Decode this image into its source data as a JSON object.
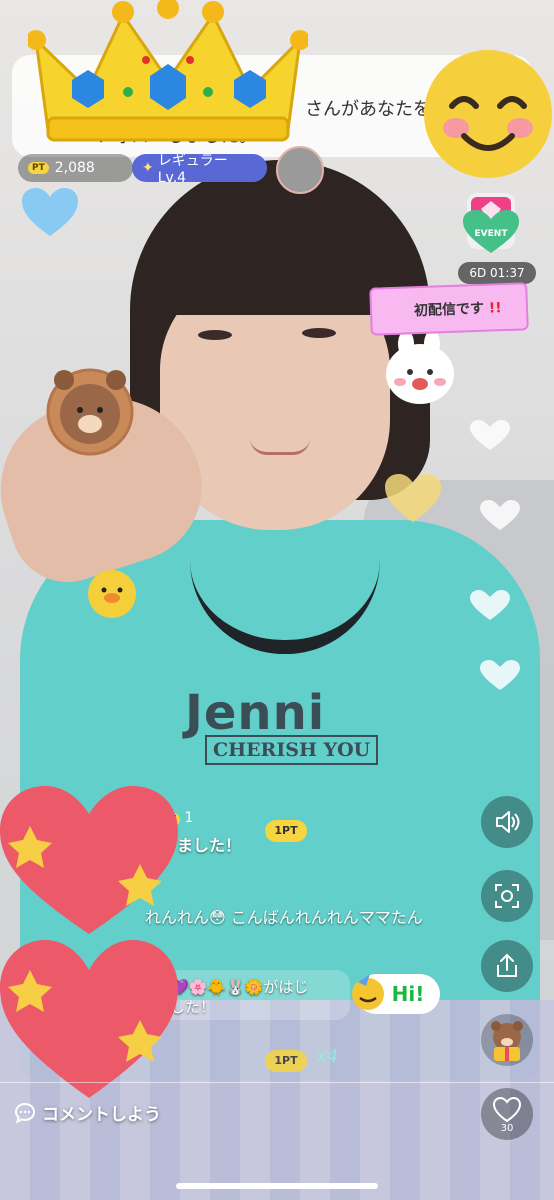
{
  "banner": {
    "line1": "さんがあなたを",
    "line2": "フォローしました。"
  },
  "badges": {
    "points": "2,088",
    "points_badge": "PT",
    "level": "レギュラー Lv.4"
  },
  "event": {
    "label": "EVENT",
    "timer": "6D 01:37"
  },
  "first_broadcast": {
    "text": "初配信です",
    "emphasis": "!!"
  },
  "shirt": {
    "brand": "Jenni",
    "sub": "CHERISH YOU"
  },
  "chat": {
    "message1_tail": "P",
    "message1_pt_badge": "PT",
    "message1_pt_value": "1",
    "message1_text": "送りました！",
    "message1_reward": "1PT",
    "message2_text": "れんれん😳 こんばんれんれんママたん",
    "message3_text": "💜🌸🐥🐰🌼がはじ",
    "message3_line2": "した！",
    "message4_reward": "1PT",
    "message4_mult": "x4"
  },
  "hi_sticker": "Hi!",
  "side_buttons": {
    "like_count": "30"
  },
  "comment_placeholder": "コメントしよう",
  "icons": {
    "sound": "speaker-icon",
    "capture": "capture-icon",
    "share": "share-icon",
    "gift": "gift-bear-icon",
    "like": "heart-icon",
    "comment": "speech-bubble-icon"
  }
}
